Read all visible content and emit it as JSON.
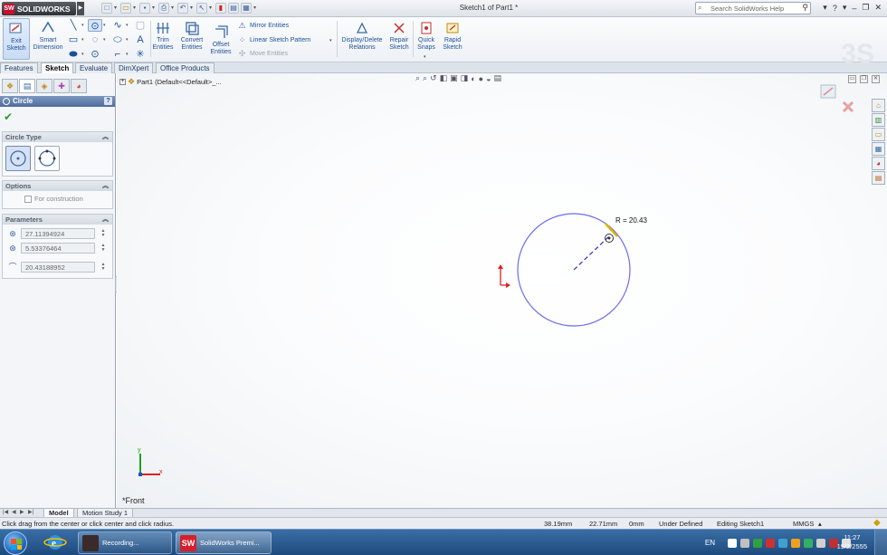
{
  "app": {
    "logo_text": "SOLIDWORKS",
    "doc_title": "Sketch1 of Part1 *"
  },
  "search": {
    "placeholder": "Search SolidWorks Help"
  },
  "ribbon": {
    "exit_sketch": "Exit Sketch",
    "smart_dimension": "Smart Dimension",
    "trim_entities": "Trim Entities",
    "convert_entities": "Convert Entities",
    "offset_entities": "Offset Entities",
    "mirror_entities": "Mirror Entities",
    "linear_sketch_pattern": "Linear Sketch Pattern",
    "move_entities": "Move Entities",
    "display_delete_relations": "Display/Delete Relations",
    "repair_sketch": "Repair Sketch",
    "quick_snaps": "Quick Snaps",
    "rapid_sketch": "Rapid Sketch"
  },
  "tabs": [
    "Features",
    "Sketch",
    "Evaluate",
    "DimXpert",
    "Office Products"
  ],
  "active_tab": "Sketch",
  "property_manager": {
    "title": "Circle",
    "help": "?",
    "circle_type_label": "Circle Type",
    "options_label": "Options",
    "for_construction": "For construction",
    "parameters_label": "Parameters",
    "center_x": "27.11394924",
    "center_y": "5.53376464",
    "radius": "20.43188952"
  },
  "graphics": {
    "tree_item": "Part1  (Default<<Default>_...",
    "radius_label": "R = 20.43",
    "view_label": "*Front",
    "axis_x": "x",
    "axis_y": "y"
  },
  "bottom_tabs": [
    "Model",
    "Motion Study 1"
  ],
  "status": {
    "hint": "Click drag from the center or click center and click radius.",
    "x": "38.19mm",
    "y": "22.71mm",
    "z": "0mm",
    "state": "Under Defined",
    "editing": "Editing Sketch1",
    "units": "MMGS"
  },
  "taskbar": {
    "task1": "Recording...",
    "task2": "SolidWorks Premi...",
    "lang": "EN",
    "time": "11:27",
    "date": "19/2/2555"
  },
  "colors": {
    "accent": "#1c4f9b",
    "circle": "#6b6bf0",
    "axis_red": "#e02020",
    "axis_green": "#20a020",
    "axis_blue": "#2050d0"
  }
}
